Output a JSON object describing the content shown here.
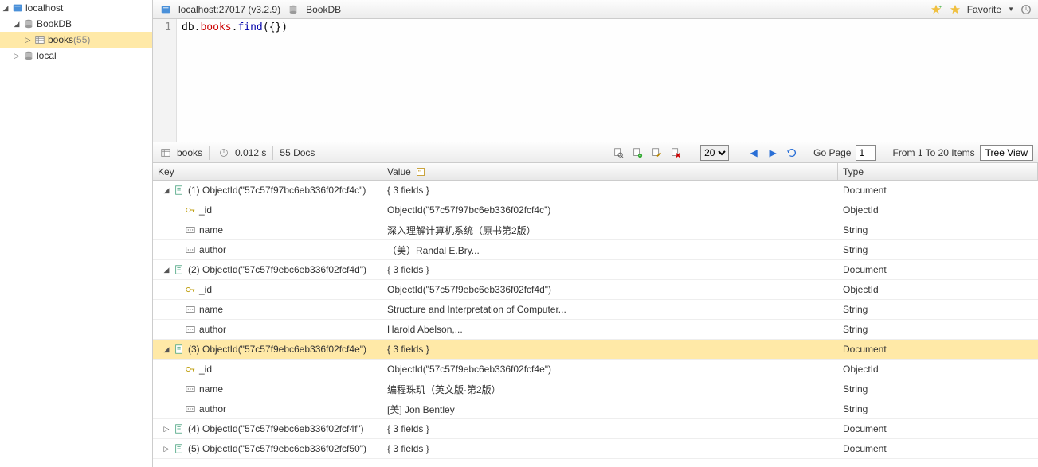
{
  "sidebar": {
    "root": {
      "label": "localhost"
    },
    "db1": {
      "label": "BookDB"
    },
    "coll1": {
      "label": "books",
      "count": "(55)"
    },
    "db2": {
      "label": "local"
    }
  },
  "header": {
    "conn": "localhost:27017 (v3.2.9)",
    "dbname": "BookDB",
    "fav_label": "Favorite"
  },
  "code": {
    "line_no": "1",
    "tok1": "db",
    "tok2": ".",
    "tok3": "books",
    "tok4": ".",
    "tok5": "find",
    "tok6": "({})"
  },
  "status": {
    "coll": "books",
    "time": "0.012 s",
    "docs": "55 Docs",
    "page_size": "20",
    "go_page_label": "Go Page",
    "go_page_val": "1",
    "range": "From 1 To 20 Items",
    "view_btn": "Tree View"
  },
  "cols": {
    "key": "Key",
    "value": "Value",
    "type": "Type"
  },
  "fieldnames": {
    "id": "_id",
    "name": "name",
    "author": "author"
  },
  "docs": [
    {
      "expanded": true,
      "selected": false,
      "key": "(1) ObjectId(\"57c57f97bc6eb336f02fcf4c\")",
      "val": "{ 3 fields }",
      "type": "Document",
      "fields": [
        {
          "name": "_id",
          "val": "ObjectId(\"57c57f97bc6eb336f02fcf4c\")",
          "type": "ObjectId",
          "icon": "key"
        },
        {
          "name": "name",
          "val": "深入理解计算机系统（原书第2版）",
          "type": "String",
          "icon": "str"
        },
        {
          "name": "author",
          "val": "（美）Randal E.Bry...",
          "type": "String",
          "icon": "str"
        }
      ]
    },
    {
      "expanded": true,
      "selected": false,
      "key": "(2) ObjectId(\"57c57f9ebc6eb336f02fcf4d\")",
      "val": "{ 3 fields }",
      "type": "Document",
      "fields": [
        {
          "name": "_id",
          "val": "ObjectId(\"57c57f9ebc6eb336f02fcf4d\")",
          "type": "ObjectId",
          "icon": "key"
        },
        {
          "name": "name",
          "val": "Structure and Interpretation of Computer...",
          "type": "String",
          "icon": "str"
        },
        {
          "name": "author",
          "val": "Harold Abelson,...",
          "type": "String",
          "icon": "str"
        }
      ]
    },
    {
      "expanded": true,
      "selected": true,
      "key": "(3) ObjectId(\"57c57f9ebc6eb336f02fcf4e\")",
      "val": "{ 3 fields }",
      "type": "Document",
      "fields": [
        {
          "name": "_id",
          "val": "ObjectId(\"57c57f9ebc6eb336f02fcf4e\")",
          "type": "ObjectId",
          "icon": "key"
        },
        {
          "name": "name",
          "val": "编程珠玑（英文版·第2版）",
          "type": "String",
          "icon": "str"
        },
        {
          "name": "author",
          "val": "[美] Jon Bentley",
          "type": "String",
          "icon": "str"
        }
      ]
    },
    {
      "expanded": false,
      "selected": false,
      "key": "(4) ObjectId(\"57c57f9ebc6eb336f02fcf4f\")",
      "val": "{ 3 fields }",
      "type": "Document",
      "fields": []
    },
    {
      "expanded": false,
      "selected": false,
      "key": "(5) ObjectId(\"57c57f9ebc6eb336f02fcf50\")",
      "val": "{ 3 fields }",
      "type": "Document",
      "fields": []
    }
  ]
}
